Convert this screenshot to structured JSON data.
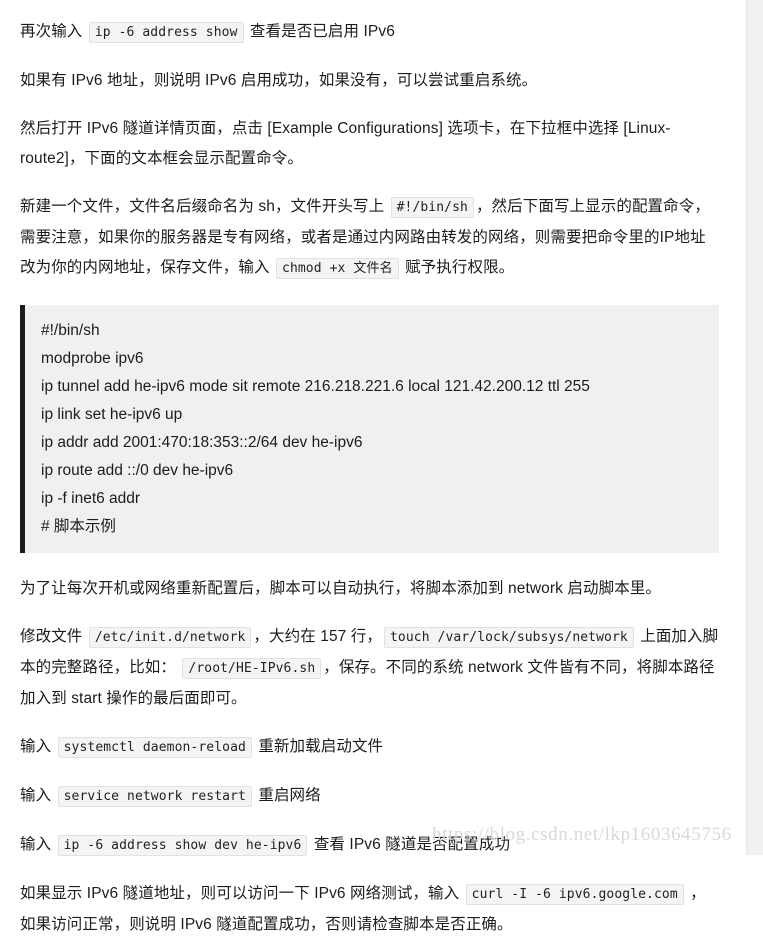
{
  "document": {
    "paragraphs": [
      {
        "id": "p-verify-ipv6",
        "parts": [
          {
            "type": "text",
            "value": "再次输入 "
          },
          {
            "type": "code",
            "value": "ip -6 address show"
          },
          {
            "type": "text",
            "value": " 查看是否已启用 IPv6"
          }
        ]
      },
      {
        "id": "p-ipv6-result",
        "parts": [
          {
            "type": "text",
            "value": "如果有 IPv6 地址，则说明 IPv6 启用成功，如果没有，可以尝试重启系统。"
          }
        ]
      },
      {
        "id": "p-example-configurations",
        "parts": [
          {
            "type": "text",
            "value": "然后打开 IPv6 隧道详情页面，点击 [Example Configurations] 选项卡，在下拉框中选择 [Linux-route2]，下面的文本框会显示配置命令。"
          }
        ]
      },
      {
        "id": "p-create-script-file",
        "parts": [
          {
            "type": "text",
            "value": "新建一个文件，文件名后缀命名为 sh，文件开头写上 "
          },
          {
            "type": "code",
            "value": "#!/bin/sh"
          },
          {
            "type": "text",
            "value": "，然后下面写上显示的配置命令，需要注意，如果你的服务器是专有网络，或者是通过内网路由转发的网络，则需要把命令里的IP地址改为你的内网地址，保存文件，输入 "
          },
          {
            "type": "code",
            "value": "chmod +x 文件名"
          },
          {
            "type": "text",
            "value": " 赋予执行权限。"
          }
        ]
      },
      {
        "id": "p-autostart-note",
        "parts": [
          {
            "type": "text",
            "value": "为了让每次开机或网络重新配置后，脚本可以自动执行，将脚本添加到 network 启动脚本里。"
          }
        ]
      },
      {
        "id": "p-edit-network-file",
        "parts": [
          {
            "type": "text",
            "value": "修改文件 "
          },
          {
            "type": "code",
            "value": "/etc/init.d/network"
          },
          {
            "type": "text",
            "value": "，大约在 157 行，"
          },
          {
            "type": "code",
            "value": "touch /var/lock/subsys/network"
          },
          {
            "type": "text",
            "value": " 上面加入脚本的完整路径，比如： "
          },
          {
            "type": "code",
            "value": "/root/HE-IPv6.sh"
          },
          {
            "type": "text",
            "value": "，保存。不同的系统 network 文件皆有不同，将脚本路径加入到 start 操作的最后面即可。"
          }
        ]
      },
      {
        "id": "p-daemon-reload",
        "parts": [
          {
            "type": "text",
            "value": "输入 "
          },
          {
            "type": "code",
            "value": "systemctl daemon-reload"
          },
          {
            "type": "text",
            "value": " 重新加载启动文件"
          }
        ]
      },
      {
        "id": "p-network-restart",
        "parts": [
          {
            "type": "text",
            "value": "输入 "
          },
          {
            "type": "code",
            "value": "service network restart"
          },
          {
            "type": "text",
            "value": " 重启网络"
          }
        ]
      },
      {
        "id": "p-show-tunnel",
        "parts": [
          {
            "type": "text",
            "value": "输入 "
          },
          {
            "type": "code",
            "value": "ip -6 address show dev he-ipv6"
          },
          {
            "type": "text",
            "value": " 查看 IPv6 隧道是否配置成功"
          }
        ]
      },
      {
        "id": "p-curl-test",
        "parts": [
          {
            "type": "text",
            "value": "如果显示 IPv6 隧道地址，则可以访问一下 IPv6 网络测试，输入 "
          },
          {
            "type": "code",
            "value": "curl -I -6 ipv6.google.com"
          },
          {
            "type": "text",
            "value": " ，如果访问正常，则说明 IPv6 隧道配置成功，否则请检查脚本是否正确。"
          }
        ]
      }
    ],
    "code_block": {
      "lines": [
        "#!/bin/sh",
        "modprobe ipv6",
        "ip tunnel add he-ipv6 mode sit remote 216.218.221.6 local 121.42.200.12 ttl 255",
        "ip link set he-ipv6 up",
        "ip addr add 2001:470:18:353::2/64 dev he-ipv6",
        "ip route add ::/0 dev he-ipv6",
        "ip -f inet6 addr",
        "# 脚本示例"
      ]
    },
    "watermark": {
      "text": "https://blog.csdn.net/lkp1603645756"
    }
  },
  "colors": {
    "page_background": "#ffffff",
    "text": "#1c1c1c",
    "inline_code_background": "#f4f4f4",
    "inline_code_border": "#e2e2e2",
    "code_block_background": "#f0f0f0",
    "code_block_accent": "#1c1c1c",
    "watermark": "#d6d9e3",
    "scrollbar_track": "#f1f1f1"
  }
}
